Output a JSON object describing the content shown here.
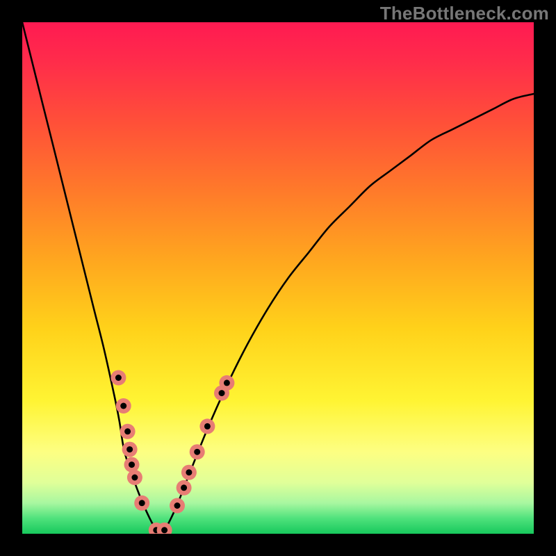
{
  "watermark": "TheBottleneck.com",
  "chart_data": {
    "type": "line",
    "title": "",
    "xlabel": "",
    "ylabel": "",
    "xlim": [
      0,
      100
    ],
    "ylim": [
      0,
      100
    ],
    "grid": false,
    "series": [
      {
        "name": "bottleneck-curve",
        "color": "#000000",
        "x": [
          0,
          2,
          4,
          6,
          8,
          10,
          12,
          14,
          16,
          18,
          19,
          20,
          22,
          24,
          26,
          27,
          28,
          30,
          32,
          36,
          40,
          44,
          48,
          52,
          56,
          60,
          64,
          68,
          72,
          76,
          80,
          84,
          88,
          92,
          96,
          100
        ],
        "y": [
          100,
          92,
          84,
          76,
          68,
          60,
          52,
          44,
          36,
          27,
          22,
          16,
          10,
          5,
          1,
          0,
          1,
          5,
          10,
          20,
          29,
          37,
          44,
          50,
          55,
          60,
          64,
          68,
          71,
          74,
          77,
          79,
          81,
          83,
          85,
          86
        ]
      }
    ],
    "markers": {
      "name": "highlight-dots",
      "color": "#e77d74",
      "radius_outer": 11,
      "radius_inner": 4.5,
      "points": [
        {
          "x": 18.8,
          "y": 30.5
        },
        {
          "x": 19.8,
          "y": 25.0
        },
        {
          "x": 20.6,
          "y": 20.0
        },
        {
          "x": 21.0,
          "y": 16.5
        },
        {
          "x": 21.4,
          "y": 13.5
        },
        {
          "x": 22.0,
          "y": 11.0
        },
        {
          "x": 23.4,
          "y": 6.0
        },
        {
          "x": 26.2,
          "y": 0.7
        },
        {
          "x": 27.8,
          "y": 0.7
        },
        {
          "x": 30.3,
          "y": 5.5
        },
        {
          "x": 31.6,
          "y": 9.0
        },
        {
          "x": 32.6,
          "y": 12.0
        },
        {
          "x": 34.2,
          "y": 16.0
        },
        {
          "x": 36.2,
          "y": 21.0
        },
        {
          "x": 39.0,
          "y": 27.5
        },
        {
          "x": 40.0,
          "y": 29.5
        }
      ]
    }
  }
}
